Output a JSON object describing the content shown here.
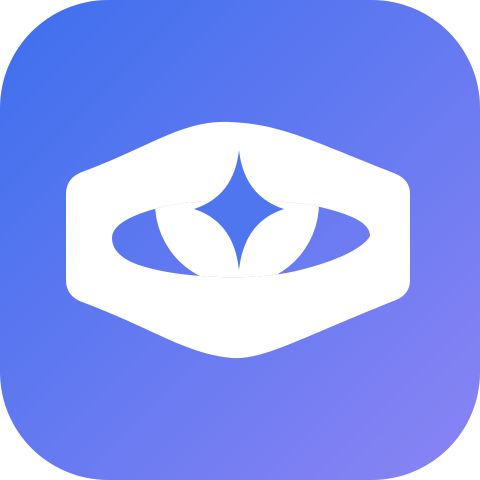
{
  "icon": {
    "name": "eye-star-app-icon",
    "background_gradient": {
      "start": "#3d6fee",
      "end": "#8b84f4"
    },
    "foreground_color": "#ffffff"
  }
}
